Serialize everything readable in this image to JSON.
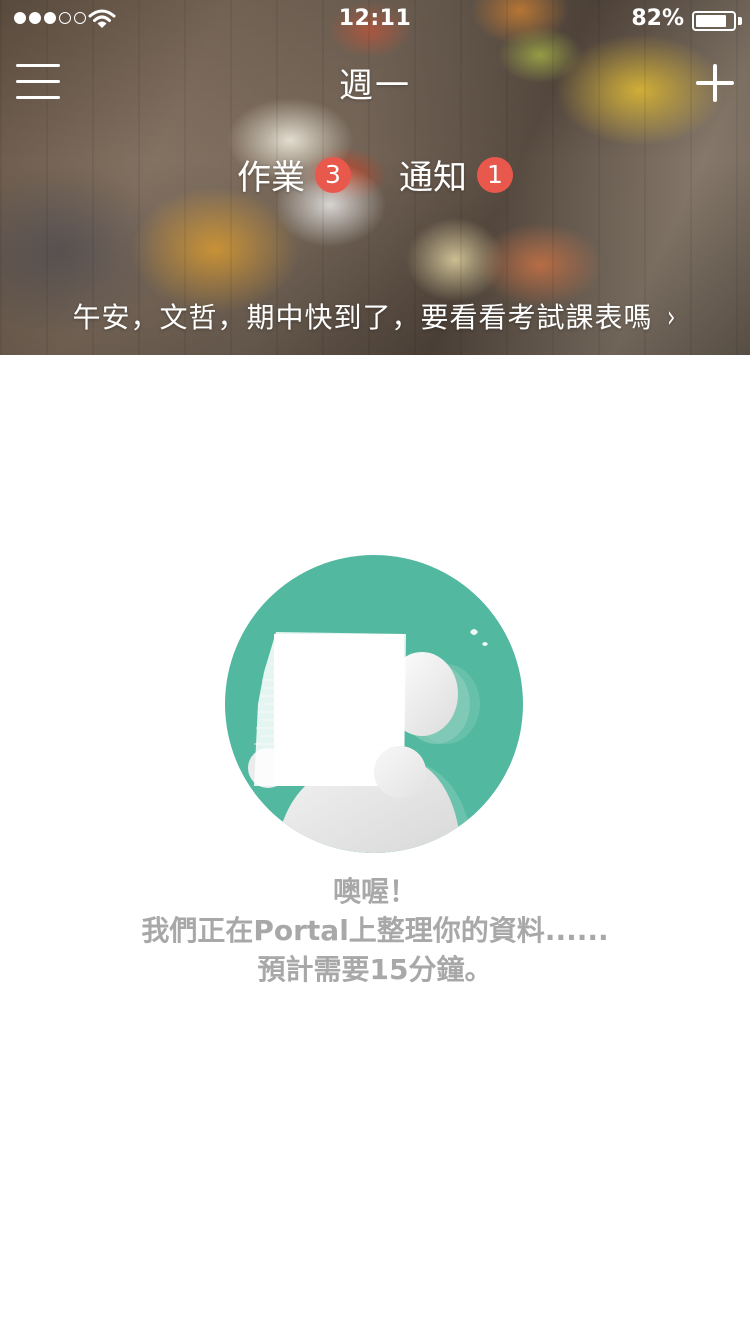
{
  "status_bar": {
    "time": "12:11",
    "battery_percent": "82%",
    "battery_level": 0.82,
    "signal_bars_filled": 3,
    "signal_bars_total": 5
  },
  "nav": {
    "title": "週一",
    "menu_icon": "hamburger-menu-icon",
    "add_icon": "plus-icon"
  },
  "tabs": [
    {
      "label": "作業",
      "badge": "3"
    },
    {
      "label": "通知",
      "badge": "1"
    }
  ],
  "greeting": {
    "text": "午安，文哲，期中快到了，要看看考試課表嗎",
    "chevron": "›"
  },
  "empty_state": {
    "illustration": "person-with-stack-of-papers-illustration",
    "accent_color": "#52b8a0",
    "line1": "噢喔！",
    "line2": "我們正在Portal上整理你的資料......",
    "line3": "預計需要15分鐘。"
  },
  "colors": {
    "badge": "#e9584c",
    "message_text": "#a8a8a8",
    "background": "#ffffff"
  }
}
